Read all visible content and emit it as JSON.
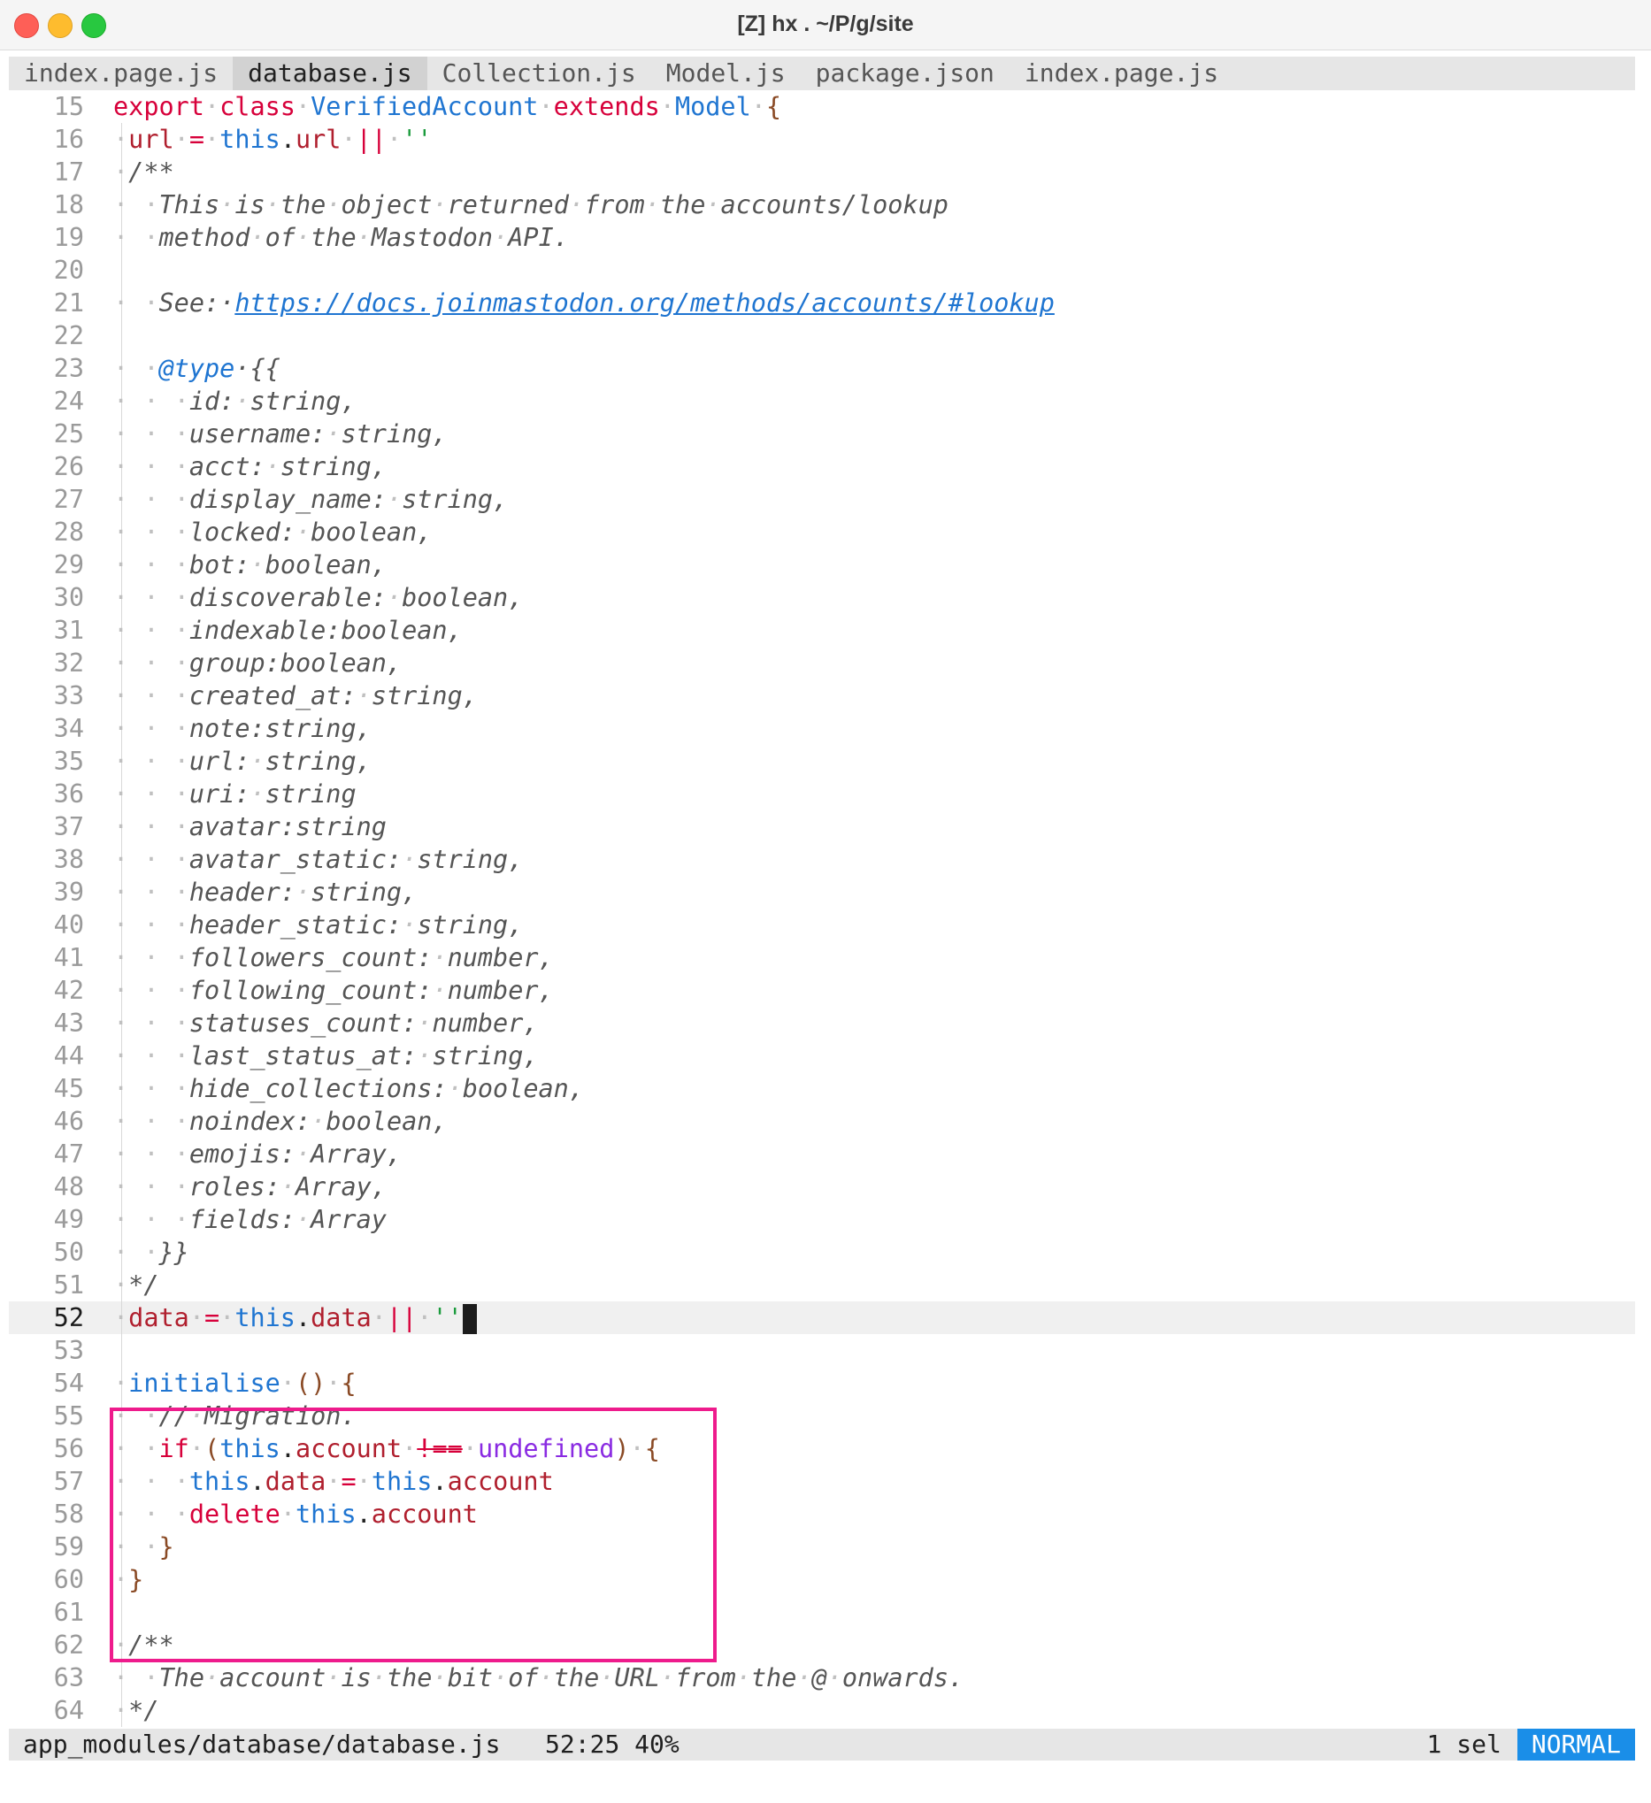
{
  "window": {
    "title": "[Z] hx . ~/P/g/site",
    "controls": [
      "close",
      "minimize",
      "zoom"
    ]
  },
  "tabs": [
    {
      "label": "index.page.js",
      "active": false
    },
    {
      "label": "database.js",
      "active": true
    },
    {
      "label": "Collection.js",
      "active": false
    },
    {
      "label": "Model.js",
      "active": false
    },
    {
      "label": "package.json",
      "active": false
    },
    {
      "label": "index.page.js",
      "active": false
    }
  ],
  "editor": {
    "current_line": "52",
    "lines": [
      {
        "n": "15",
        "code": "export class VerifiedAccount extends Model {"
      },
      {
        "n": "16",
        "code": "url = this.url || ''"
      },
      {
        "n": "17",
        "code": "/**"
      },
      {
        "n": "18",
        "code": "This is the object returned from the accounts/lookup"
      },
      {
        "n": "19",
        "code": "method of the Mastodon API."
      },
      {
        "n": "20",
        "code": ""
      },
      {
        "n": "21",
        "code": "See: https://docs.joinmastodon.org/methods/accounts/#lookup"
      },
      {
        "n": "22",
        "code": ""
      },
      {
        "n": "23",
        "code": "@type {{"
      },
      {
        "n": "24",
        "code": "id: string,"
      },
      {
        "n": "25",
        "code": "username: string,"
      },
      {
        "n": "26",
        "code": "acct: string,"
      },
      {
        "n": "27",
        "code": "display_name: string,"
      },
      {
        "n": "28",
        "code": "locked: boolean,"
      },
      {
        "n": "29",
        "code": "bot: boolean,"
      },
      {
        "n": "30",
        "code": "discoverable: boolean,"
      },
      {
        "n": "31",
        "code": "indexable:boolean,"
      },
      {
        "n": "32",
        "code": "group:boolean,"
      },
      {
        "n": "33",
        "code": "created_at: string,"
      },
      {
        "n": "34",
        "code": "note:string,"
      },
      {
        "n": "35",
        "code": "url: string,"
      },
      {
        "n": "36",
        "code": "uri: string"
      },
      {
        "n": "37",
        "code": "avatar:string"
      },
      {
        "n": "38",
        "code": "avatar_static: string,"
      },
      {
        "n": "39",
        "code": "header: string,"
      },
      {
        "n": "40",
        "code": "header_static: string,"
      },
      {
        "n": "41",
        "code": "followers_count: number,"
      },
      {
        "n": "42",
        "code": "following_count: number,"
      },
      {
        "n": "43",
        "code": "statuses_count: number,"
      },
      {
        "n": "44",
        "code": "last_status_at: string,"
      },
      {
        "n": "45",
        "code": "hide_collections: boolean,"
      },
      {
        "n": "46",
        "code": "noindex: boolean,"
      },
      {
        "n": "47",
        "code": "emojis: Array,"
      },
      {
        "n": "48",
        "code": "roles: Array,"
      },
      {
        "n": "49",
        "code": "fields: Array"
      },
      {
        "n": "50",
        "code": "}}"
      },
      {
        "n": "51",
        "code": "*/"
      },
      {
        "n": "52",
        "code": "data = this.data || ''"
      },
      {
        "n": "53",
        "code": ""
      },
      {
        "n": "54",
        "code": "initialise () {"
      },
      {
        "n": "55",
        "code": "// Migration."
      },
      {
        "n": "56",
        "code": "if (this.account !== undefined) {"
      },
      {
        "n": "57",
        "code": "this.data = this.account"
      },
      {
        "n": "58",
        "code": "delete this.account"
      },
      {
        "n": "59",
        "code": "}"
      },
      {
        "n": "60",
        "code": "}"
      },
      {
        "n": "61",
        "code": ""
      },
      {
        "n": "62",
        "code": "/**"
      },
      {
        "n": "63",
        "code": "The account is the bit of the URL from the @ onwards."
      },
      {
        "n": "64",
        "code": "*/"
      }
    ]
  },
  "statusbar": {
    "path": "app_modules/database/database.js",
    "position": "52:25",
    "percent": "40%",
    "selections": "1 sel",
    "mode": "NORMAL"
  },
  "colors": {
    "keyword": "#d7003a",
    "class": "#1f75d1",
    "string": "#1a9b3c",
    "comment": "#555555",
    "constant": "#8a2be2",
    "mode_badge": "#1a8ee8",
    "highlight_box": "#ee1b8c"
  }
}
